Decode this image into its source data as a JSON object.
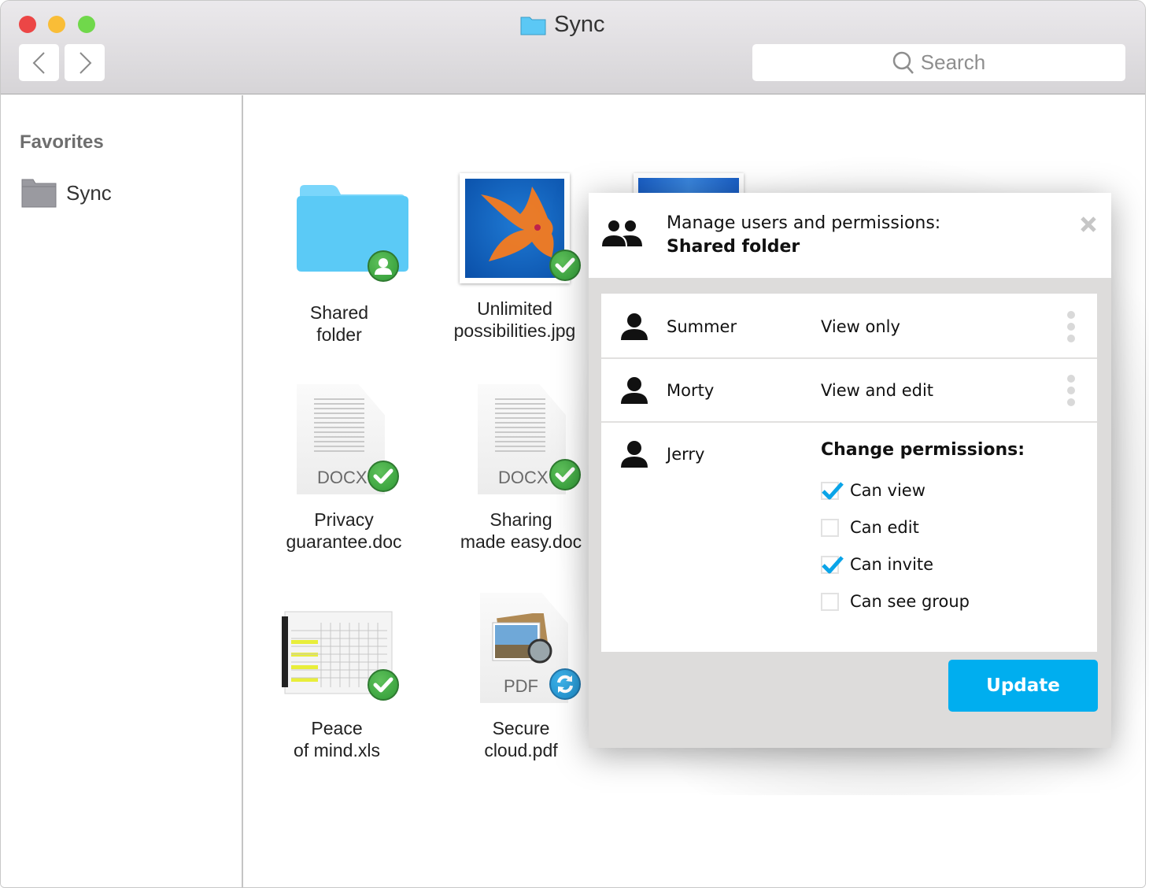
{
  "window": {
    "title": "Sync",
    "search_placeholder": "Search"
  },
  "sidebar": {
    "heading": "Favorites",
    "items": [
      {
        "label": "Sync",
        "icon": "folder-icon"
      }
    ]
  },
  "files": [
    {
      "name_line1": "Shared",
      "name_line2": "folder",
      "type": "folder",
      "status": "shared"
    },
    {
      "name_line1": "Unlimited",
      "name_line2": "possibilities.jpg",
      "type": "image",
      "status": "synced"
    },
    {
      "name_line1": "Privacy",
      "name_line2": "guarantee.doc",
      "type": "docx",
      "label": "DOCX",
      "status": "synced"
    },
    {
      "name_line1": "Sharing",
      "name_line2": "made easy.doc",
      "type": "docx",
      "label": "DOCX",
      "status": "synced"
    },
    {
      "name_line1": "Peace",
      "name_line2": "of mind.xls",
      "type": "spreadsheet",
      "status": "synced"
    },
    {
      "name_line1": "Secure",
      "name_line2": "cloud.pdf",
      "type": "pdf",
      "label": "PDF",
      "status": "syncing"
    }
  ],
  "dialog": {
    "title": "Manage users and permissions:",
    "subtitle": "Shared folder",
    "users": [
      {
        "name": "Summer",
        "permission": "View only"
      },
      {
        "name": "Morty",
        "permission": "View and edit"
      },
      {
        "name": "Jerry",
        "permission": ""
      }
    ],
    "change_heading": "Change permissions:",
    "options": [
      {
        "label": "Can view",
        "checked": true
      },
      {
        "label": "Can edit",
        "checked": false
      },
      {
        "label": "Can invite",
        "checked": true
      },
      {
        "label": "Can see group",
        "checked": false
      }
    ],
    "update_label": "Update"
  },
  "colors": {
    "accent": "#00aeef",
    "synced_badge": "#3a9d3c",
    "sync_badge": "#2a9ad6",
    "close_red": "#ec4646",
    "minimize_yellow": "#f9bd37",
    "zoom_green": "#70d84b"
  }
}
